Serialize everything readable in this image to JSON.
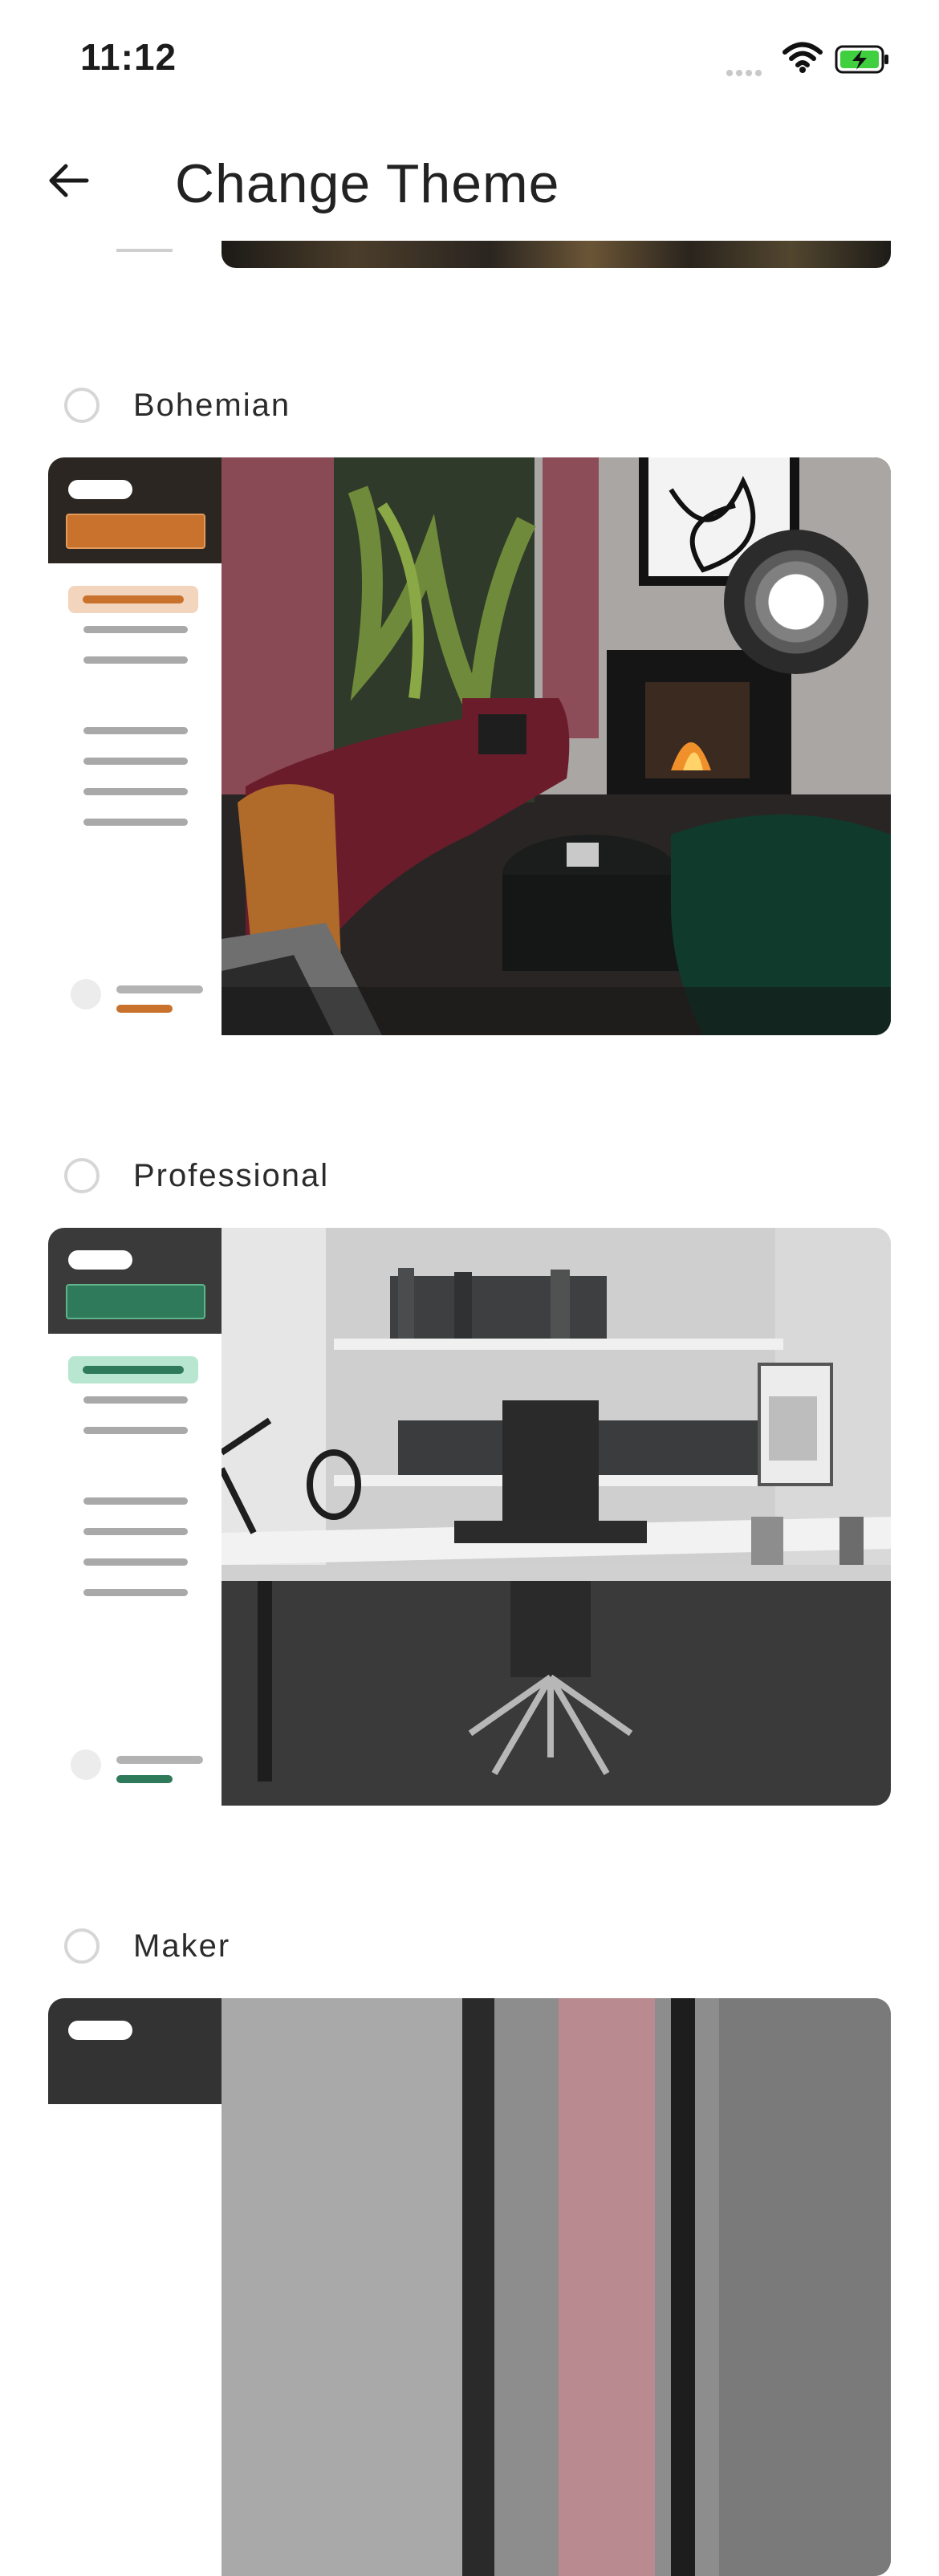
{
  "status_bar": {
    "time": "11:12"
  },
  "app_bar": {
    "title": "Change Theme"
  },
  "themes": [
    {
      "label": "Bohemian",
      "selected": false,
      "accent": "#c8722e",
      "header_color": "#2b2622",
      "selected_bg": "#f3d5bd"
    },
    {
      "label": "Professional",
      "selected": false,
      "accent": "#2f7a5a",
      "header_color": "#3a3a3a",
      "selected_bg": "#b8e6d0"
    },
    {
      "label": "Maker",
      "selected": false,
      "accent": "#777777",
      "header_color": "#333333",
      "selected_bg": "#dddddd"
    }
  ],
  "icons": {
    "back": "arrow-left-icon",
    "wifi": "wifi-icon",
    "battery": "battery-charging-icon",
    "signal": "signal-icon"
  },
  "colors": {
    "text": "#222222",
    "radio_border": "#d6d6d6",
    "battery_green": "#3fcf3f"
  }
}
